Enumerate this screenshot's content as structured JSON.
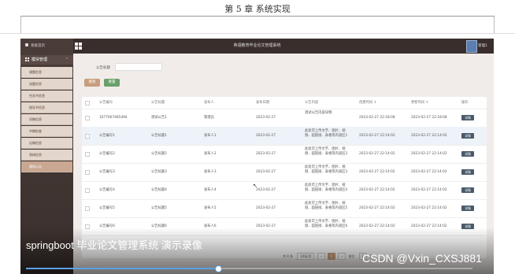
{
  "document": {
    "header": "第 5 章  系统实现"
  },
  "app": {
    "title": "英语教育毕业论文管理系统",
    "user": "管理1",
    "icon_grid": "grid-icon",
    "colors": {
      "topbar": "#3a2e2c",
      "sidebar": "#4a3c38",
      "accent": "#c89e7e",
      "add": "#6aa06a",
      "detail": "#4a5a6a"
    }
  },
  "sidebar": {
    "home": "系统首页",
    "group": "模块管理",
    "items": [
      {
        "label": "课题信息"
      },
      {
        "label": "选题信息"
      },
      {
        "label": "任务书信息"
      },
      {
        "label": "指导书信息"
      },
      {
        "label": "初稿信息"
      },
      {
        "label": "中期检查"
      },
      {
        "label": "论稿信息"
      },
      {
        "label": "答辩信息"
      },
      {
        "label": "通知公告"
      }
    ]
  },
  "search": {
    "label": "公告标题",
    "placeholder": "",
    "search_label": "搜索",
    "add_label": "重置"
  },
  "table": {
    "headers": [
      "公告编号",
      "公告标题",
      "发布人",
      "发布日期",
      "公告内容",
      "创建时间 ↕",
      "更新时间 ↕",
      "操作"
    ],
    "rows": [
      {
        "no": "1677067485494",
        "title": "测试公告1",
        "author": "管理员",
        "date": "2023-02-27",
        "content": "测试公告内容详情",
        "created": "2023-02-27 22:18:08",
        "updated": "2023-02-27 22:18:08",
        "action": "详情"
      },
      {
        "no": "公告编号1",
        "title": "公告标题1",
        "author": "发布人1",
        "date": "2023-02-27",
        "content": "此处可上传文字、图片、视频、超链接、表格等内容区1",
        "created": "2023-02-27 22:14:02",
        "updated": "2023-02-27 22:14:02",
        "action": "详情"
      },
      {
        "no": "公告编号2",
        "title": "公告标题2",
        "author": "发布人2",
        "date": "2023-02-27",
        "content": "此处可上传文字、图片、视频、超链接、表格等内容区2",
        "created": "2023-02-27 22:14:02",
        "updated": "2023-02-27 22:14:02",
        "action": "详情"
      },
      {
        "no": "公告编号3",
        "title": "公告标题3",
        "author": "发布人3",
        "date": "2023-02-27",
        "content": "此处可上传文字、图片、视频、超链接、表格等内容区3",
        "created": "2023-02-27 22:14:02",
        "updated": "2023-02-27 22:14:02",
        "action": "详情"
      },
      {
        "no": "公告编号4",
        "title": "公告标题4",
        "author": "发布人4",
        "date": "2023-02-27",
        "content": "此处可上传文字、图片、视频、超链接、表格等内容区4",
        "created": "2023-02-27 22:14:02",
        "updated": "2023-02-27 22:14:02",
        "action": "详情"
      },
      {
        "no": "公告编号5",
        "title": "公告标题5",
        "author": "发布人5",
        "date": "2023-02-27",
        "content": "此处可上传文字、图片、视频、超链接、表格等内容区5",
        "created": "2023-02-27 22:14:02",
        "updated": "2023-02-27 22:14:02",
        "action": "详情"
      },
      {
        "no": "公告编号6",
        "title": "公告标题6",
        "author": "发布人6",
        "date": "2023-02-27",
        "content": "此处可上传文字、图片、视频、超链接、表格等内容区6",
        "created": "2023-02-27 22:14:02",
        "updated": "2023-02-27 22:14:02",
        "action": "详情"
      }
    ]
  },
  "pager": {
    "total": "共 8 条",
    "size": "10条/页",
    "current": "1",
    "goto": "前往",
    "page_input": "1",
    "page_unit": "页"
  },
  "video": {
    "caption": "springboot 毕业论文管理系统 演示录像",
    "watermark": "CSDN @Vxin_CXSJ881",
    "progress": 0.43
  }
}
